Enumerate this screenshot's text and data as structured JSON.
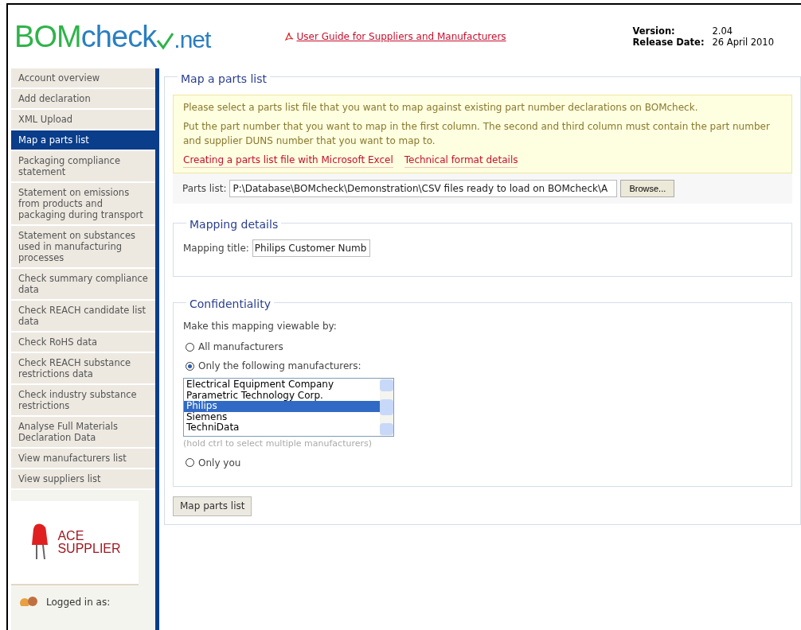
{
  "header": {
    "logo": {
      "part_1": "BOM",
      "part_2": "check",
      "part_3": ".net"
    },
    "guide_link": "User Guide for Suppliers and Manufacturers",
    "version_label": "Version:",
    "version": "2.04",
    "release_label": "Release Date:",
    "release_date": "26 April 2010"
  },
  "sidebar": {
    "items": [
      {
        "label": "Account overview",
        "selected": false
      },
      {
        "label": "Add declaration",
        "selected": false
      },
      {
        "label": "XML Upload",
        "selected": false
      },
      {
        "label": "Map a parts list",
        "selected": true
      },
      {
        "label": "Packaging compliance statement",
        "selected": false
      },
      {
        "label": "Statement on emissions from products and packaging during transport",
        "selected": false
      },
      {
        "label": "Statement on substances used in manufacturing processes",
        "selected": false
      },
      {
        "label": "Check summary compliance data",
        "selected": false
      },
      {
        "label": "Check REACH candidate list data",
        "selected": false
      },
      {
        "label": "Check RoHS data",
        "selected": false
      },
      {
        "label": "Check REACH substance restrictions data",
        "selected": false
      },
      {
        "label": "Check industry substance restrictions",
        "selected": false
      },
      {
        "label": "Analyse Full Materials Declaration Data",
        "selected": false
      },
      {
        "label": "View manufacturers list",
        "selected": false
      },
      {
        "label": "View suppliers list",
        "selected": false
      }
    ],
    "company_logo": {
      "line_1": "ACE",
      "line_2": "SUPPLIER"
    },
    "logged_in": "Logged in as:"
  },
  "main": {
    "title": "Map a parts list",
    "notice": {
      "line_1": "Please select a parts list file that you want to map against existing part number declarations on BOMcheck.",
      "line_2": "Put the part number that you want to map in the first column. The second and third column must contain the part number and supplier DUNS number that you want to map to.",
      "links": [
        "Creating a parts list file with Microsoft Excel",
        "Technical format details"
      ]
    },
    "parts_list": {
      "label": "Parts list:",
      "value": "P:\\Database\\BOMcheck\\Demonstration\\CSV files ready to load on BOMcheck\\A",
      "button": "Browse..."
    },
    "mapping_details": {
      "title": "Mapping details",
      "label": "Mapping title:",
      "value": "Philips Customer Numb"
    },
    "confidentiality": {
      "title": "Confidentiality",
      "prompt": "Make this mapping viewable by:",
      "options": [
        {
          "kind": "radio",
          "label": "All manufacturers",
          "selected": false
        },
        {
          "kind": "list",
          "label": "Only the following manufacturers:",
          "selected": true,
          "list": [
            {
              "label": "Electrical Equipment Company",
              "selected": false
            },
            {
              "label": "Parametric Technology Corp.",
              "selected": false
            },
            {
              "label": "Philips",
              "selected": true
            },
            {
              "label": "Siemens",
              "selected": false
            },
            {
              "label": "TechniData",
              "selected": false
            }
          ],
          "hint": "(hold ctrl to select multiple manufacturers)"
        },
        {
          "kind": "radio",
          "label": "Only you",
          "selected": false
        }
      ]
    },
    "submit": "Map parts list"
  }
}
